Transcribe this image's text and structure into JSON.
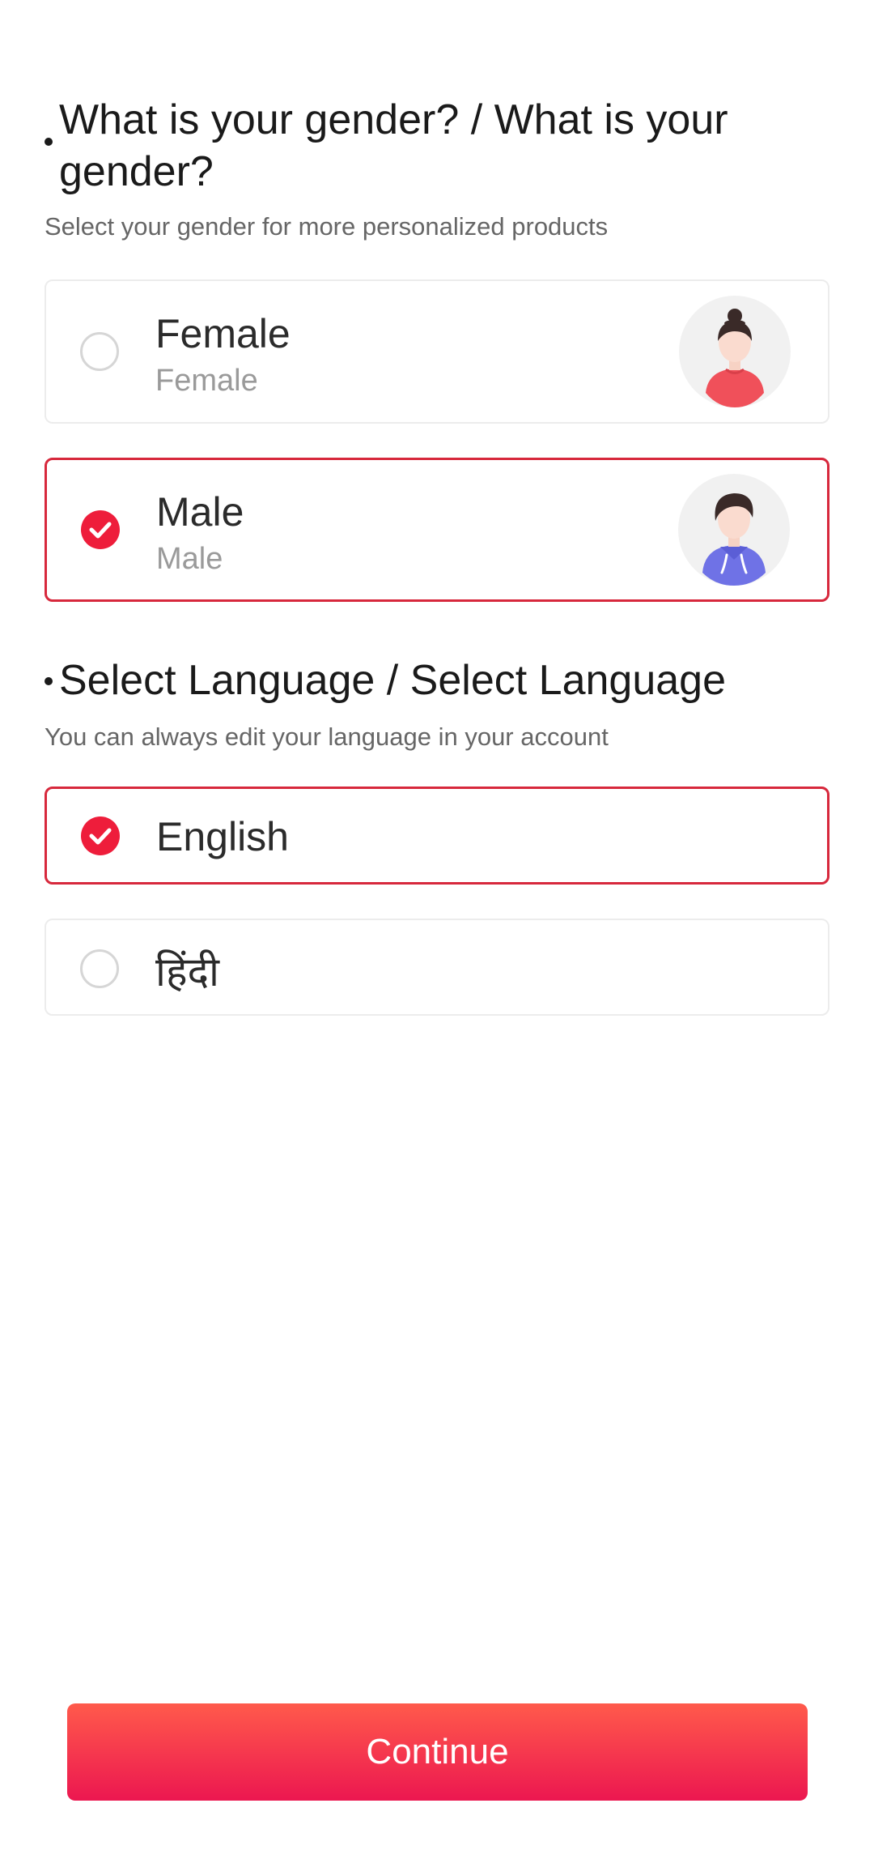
{
  "gender_section": {
    "title": "What is your gender? / What is your gender?",
    "subtitle": "Select your gender for more personalized products",
    "options": [
      {
        "label": "Female",
        "sublabel": "Female",
        "selected": false
      },
      {
        "label": "Male",
        "sublabel": "Male",
        "selected": true
      }
    ]
  },
  "language_section": {
    "title": "Select Language / Select Language",
    "subtitle": "You can always edit your language in your account",
    "options": [
      {
        "label": "English",
        "selected": true
      },
      {
        "label": "हिंदी",
        "selected": false
      }
    ]
  },
  "continue_button": {
    "label": "Continue"
  },
  "colors": {
    "accent": "#ee1d3b",
    "selected_border": "#d7283c",
    "button_gradient_top": "#ff5a4b",
    "button_gradient_bottom": "#ec1750",
    "female_avatar_shirt": "#f0505a",
    "male_avatar_shirt": "#6f72e6"
  },
  "icons": {
    "checked": "check-circle-icon",
    "unchecked": "empty-circle-icon",
    "female_avatar": "female-avatar-icon",
    "male_avatar": "male-avatar-icon"
  }
}
